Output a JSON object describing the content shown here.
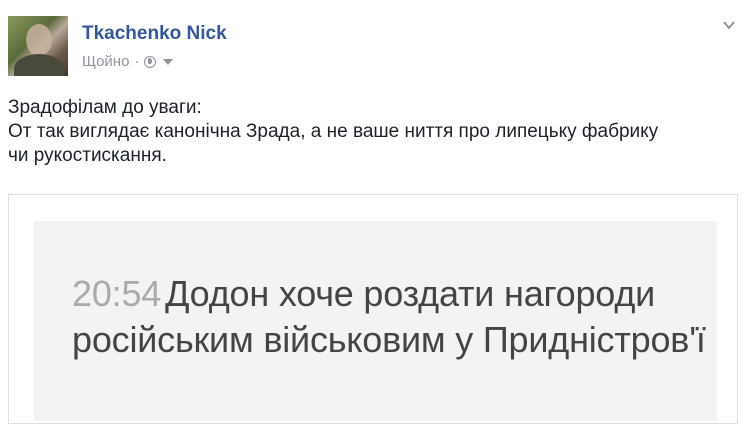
{
  "author": {
    "name": "Tkachenko Nick",
    "time": "Щойно",
    "separator": "·",
    "privacy_icon": "globe-icon",
    "audience_dropdown_icon": "caret-down-icon"
  },
  "post_menu_icon": "chevron-down-icon",
  "post": {
    "lines": [
      "Зрадофілам до уваги:",
      "От так виглядає канонічна Зрада, а не ваше ниття про липецьку фабрику",
      "чи рукостискання."
    ]
  },
  "attachment": {
    "time": "20:54",
    "headline_line1": "Додон хоче роздати нагороди",
    "headline_line2": "російським військовим у Придністров'ї"
  },
  "colors": {
    "link": "#365899",
    "text": "#1d2129",
    "meta": "#90949c",
    "headline": "#444444",
    "headline_time": "#aaaaaa",
    "attachment_bg": "#f3f3f3"
  }
}
